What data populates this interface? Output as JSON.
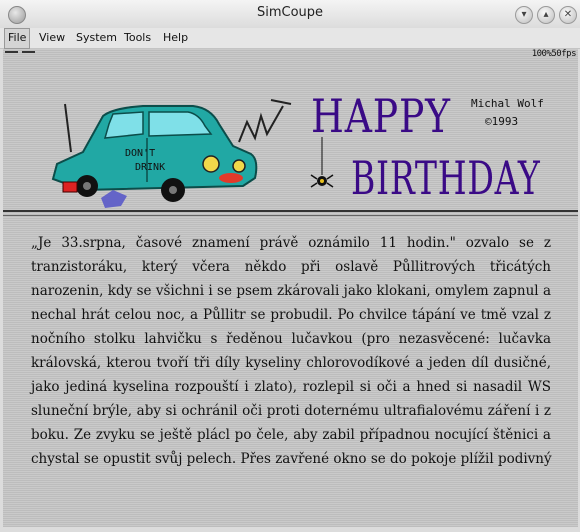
{
  "window": {
    "title": "SimCoupe"
  },
  "menubar": {
    "items": [
      "File",
      "View",
      "System",
      "Tools",
      "Help"
    ]
  },
  "status": {
    "fps": "100%50fps"
  },
  "banner": {
    "happy": "HAPPY",
    "birthday": "BIRTHDAY",
    "author": "Michal Wolf",
    "year": "©1993",
    "car_sign": [
      "DON'T",
      "DRINK"
    ]
  },
  "article": {
    "lines": [
      "„Je 33.srpna, časové znamení právě oznámilo 11 hodin.\" ozvalo se z",
      "tranzistoráku, který včera někdo při oslavě Půllitrových třicátých",
      "narozenin, kdy se všichni i se psem zkárovali jako klokani, omylem zapnul a",
      "nechal hrát celou noc, a Půllitr se probudil. Po chvilce tápání ve tmě vzal z",
      "nočního stolku lahvičku s ředěnou lučavkou (pro nezasvěcené: lučavka",
      "královská, kterou tvoří tři díly kyseliny chlorovodíkové a jeden díl dusičné,",
      "jako jediná kyselina rozpouští i zlato), rozlepil si oči a hned si nasadil WS",
      "sluneční brýle, aby si ochránil oči proti doternému ultrafialovému záření i z",
      "boku. Ze zvyku se ještě plácl po čele, aby zabil případnou nocující štěnici a",
      "chystal se opustit svůj pelech. Přes zavřené okno se do pokoje plížil podivný"
    ]
  }
}
